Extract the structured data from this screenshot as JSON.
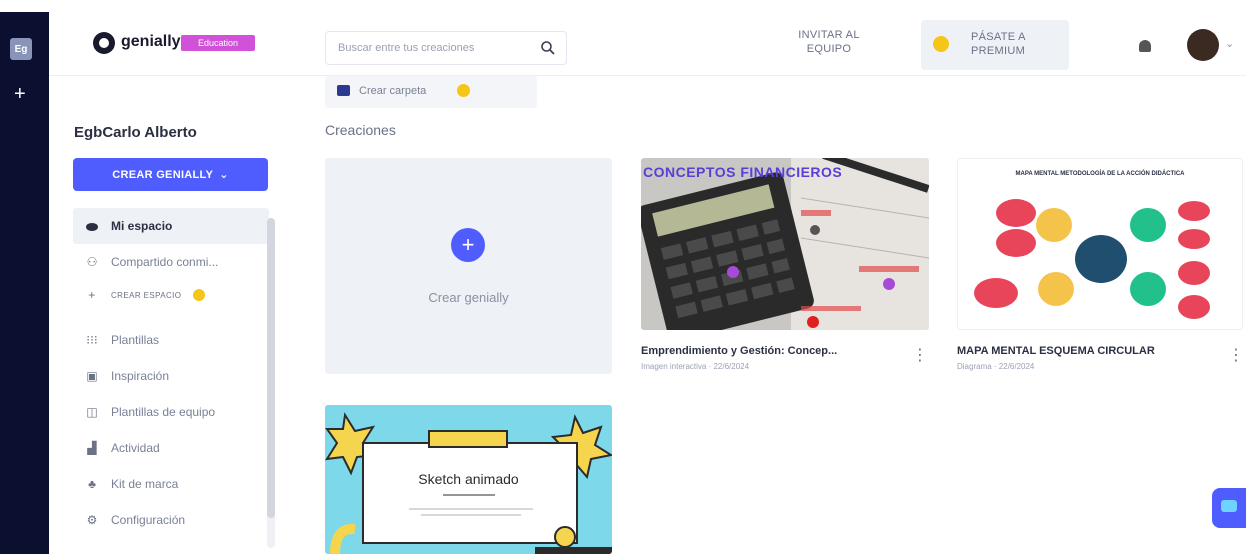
{
  "rail": {
    "workspace_initials": "Eg",
    "add_symbol": "+"
  },
  "topbar": {
    "logo_text": "genially",
    "logo_badge": "Education",
    "search_placeholder": "Buscar entre tus creaciones",
    "invite_line1": "INVITAR AL",
    "invite_line2": "EQUIPO",
    "premium_line1": "PÁSATE A",
    "premium_line2": "PREMIUM"
  },
  "sidebar": {
    "user_name": "EgbCarlo Alberto",
    "create_button": "CREAR GENIALLY",
    "items": [
      {
        "label": "Mi espacio",
        "icon": "cloud-icon"
      },
      {
        "label": "Compartido conmi...",
        "icon": "people-icon"
      },
      {
        "label": "CREAR ESPACIO",
        "icon": "plus-icon"
      },
      {
        "label": "Plantillas",
        "icon": "grid-icon"
      },
      {
        "label": "Inspiración",
        "icon": "book-icon"
      },
      {
        "label": "Plantillas de equipo",
        "icon": "team-templates-icon"
      },
      {
        "label": "Actividad",
        "icon": "chart-icon"
      },
      {
        "label": "Kit de marca",
        "icon": "brand-kit-icon"
      },
      {
        "label": "Configuración",
        "icon": "gear-icon"
      }
    ]
  },
  "main": {
    "folder_button": "Crear carpeta",
    "section_title": "Creaciones",
    "new_card_label": "Crear genially",
    "cards": [
      {
        "title": "Emprendimiento y Gestión: Concep...",
        "subtitle": "Imagen interactiva · 22/6/2024",
        "thumb_heading": "CONCEPTOS FINANCIEROS"
      },
      {
        "title": "MAPA MENTAL ESQUEMA CIRCULAR",
        "subtitle": "Diagrama · 22/6/2024",
        "thumb_heading": "MAPA MENTAL METODOLOGÍA DE LA ACCIÓN DIDÁCTICA"
      },
      {
        "title": "",
        "subtitle": "",
        "thumb_heading": "Sketch animado"
      }
    ]
  },
  "colors": {
    "accent": "#4f5dff",
    "rail": "#0b1030",
    "badge": "#d152d8",
    "star": "#f5c518"
  }
}
